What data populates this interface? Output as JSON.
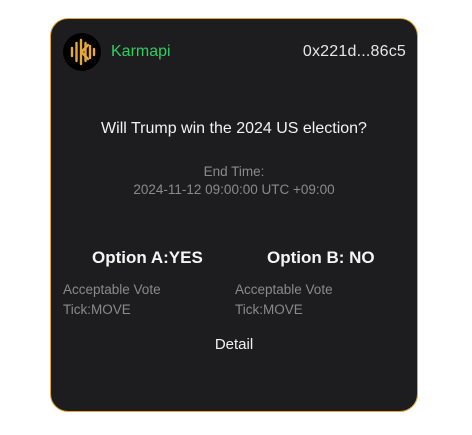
{
  "header": {
    "logo_icon": "karmapi-logo-icon",
    "brand": "Karmapi",
    "brand_color": "#2fce5f",
    "address": "0x221d...86c5"
  },
  "market": {
    "question": "Will Trump win the 2024 US election?",
    "end_time_label": "End Time:",
    "end_time_value": "2024-11-12 09:00:00 UTC +09:00"
  },
  "options": [
    {
      "title": "Option A:YES",
      "vote_line": "Acceptable Vote",
      "tick_line": "Tick:MOVE"
    },
    {
      "title": "Option B: NO",
      "vote_line": "Acceptable Vote",
      "tick_line": "Tick:MOVE"
    }
  ],
  "detail_label": "Detail",
  "colors": {
    "card_background": "#1d1d1f",
    "card_border": "#e0a535",
    "logo_accent": "#e8a73a"
  }
}
